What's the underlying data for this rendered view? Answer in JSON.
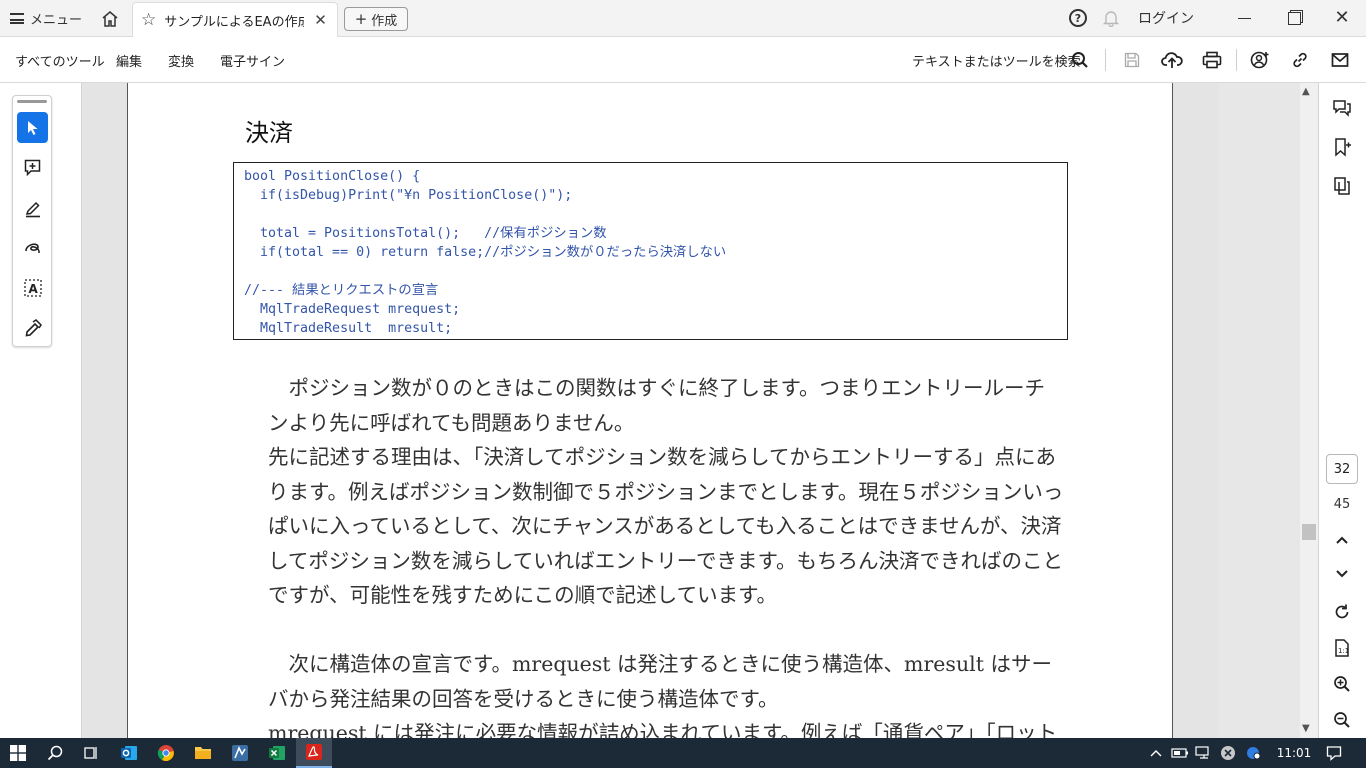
{
  "titlebar": {
    "menu_label": "メニュー",
    "tab_title": "サンプルによるEAの作成...",
    "create_label": "作成",
    "login_label": "ログイン"
  },
  "toolbar": {
    "items": [
      "すべてのツール",
      "編集",
      "変換",
      "電子サイン"
    ],
    "search_label": "テキストまたはツールを検索"
  },
  "document": {
    "section_title": "決済",
    "code_lines": [
      "bool PositionClose() {",
      "  if(isDebug)Print(\"¥n PositionClose()\");",
      "",
      "  total = PositionsTotal();   //保有ポジション数",
      "  if(total == 0) return false;//ポジション数が０だったら決済しない",
      "",
      "//--- 結果とリクエストの宣言",
      "  MqlTradeRequest mrequest;",
      "  MqlTradeResult  mresult;"
    ],
    "paragraph1": [
      "　ポジション数が０のときはこの関数はすぐに終了します。つまりエントリールーチ",
      "ンより先に呼ばれても問題ありません。",
      "先に記述する理由は、「決済してポジション数を減らしてからエントリーする」点にあ",
      "ります。例えばポジション数制御で５ポジションまでとします。現在５ポジションいっ",
      "ぱいに入っているとして、次にチャンスがあるとしても入ることはできませんが、決済",
      "してポジション数を減らしていればエントリーできます。もちろん決済できればのこと",
      "ですが、可能性を残すためにこの順で記述しています。"
    ],
    "paragraph2": [
      "　次に構造体の宣言です。mrequest は発注するときに使う構造体、mresult はサー",
      "バから発注結果の回答を受けるときに使う構造体です。",
      "mrequest には発注に必要な情報が詰め込まれています。例えば「通貨ペア」「ロット"
    ]
  },
  "navigation": {
    "current_page": "32",
    "total_pages": "45"
  },
  "taskbar": {
    "clock": "11:01"
  }
}
